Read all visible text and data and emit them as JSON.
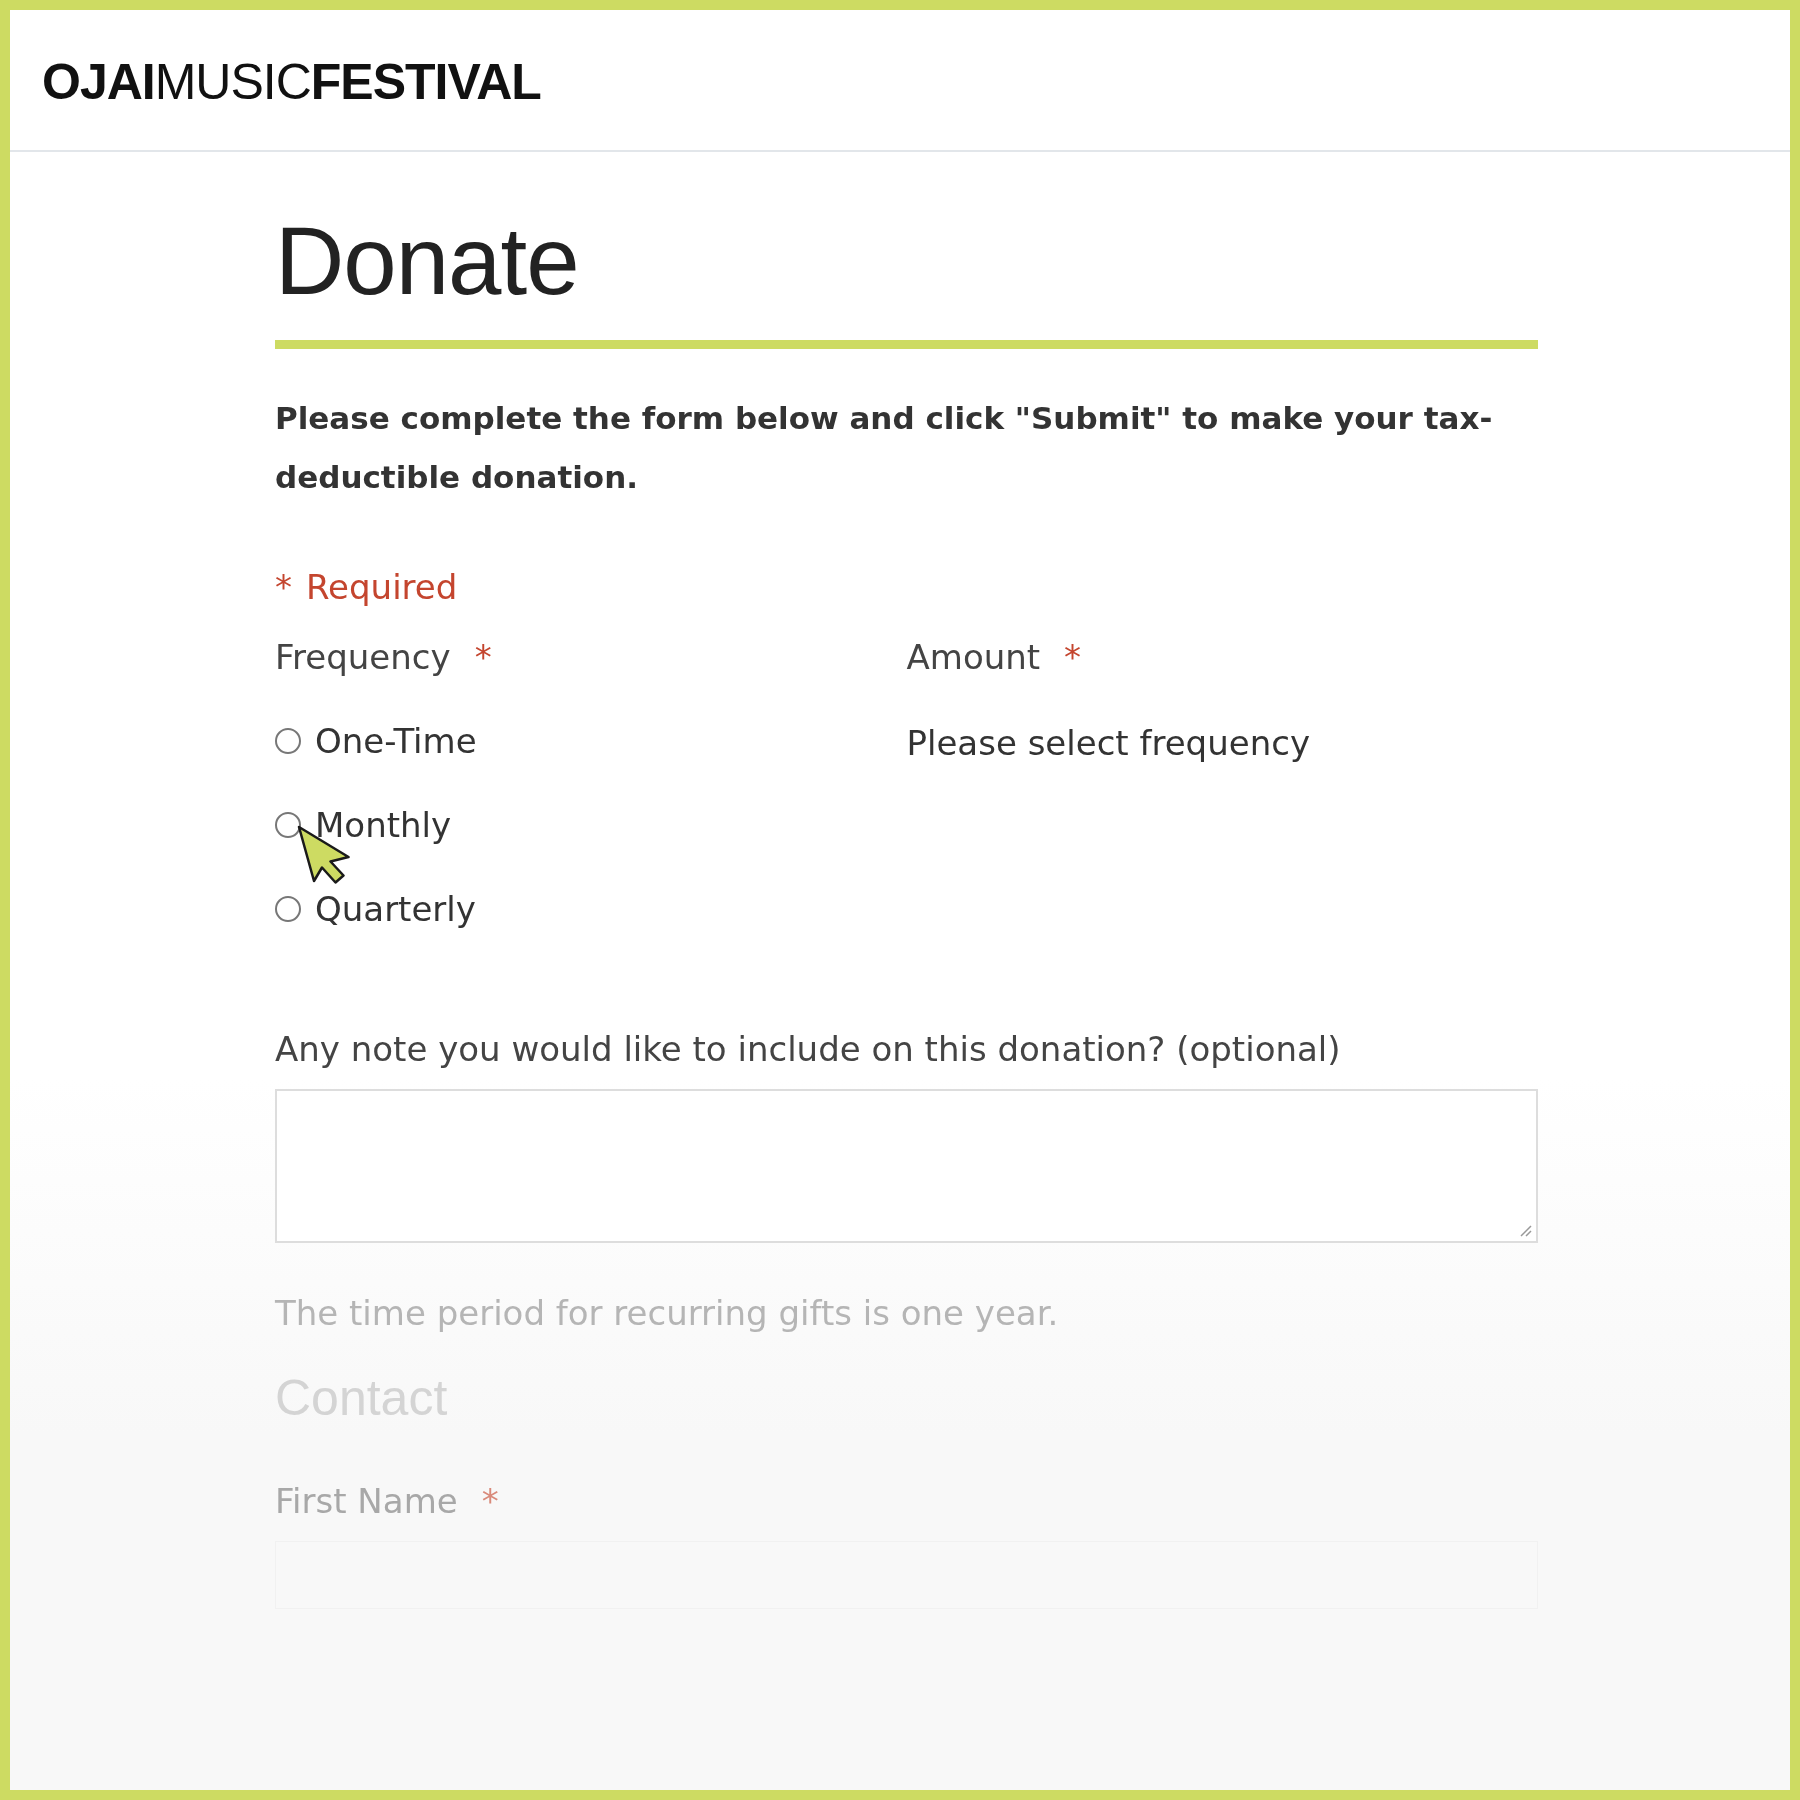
{
  "header": {
    "logo": "**OJAI**MUSIC**FESTIVAL**"
  },
  "title": "Donate",
  "intro": "Please complete the form below and click \"Submit\" to make your tax-deductible donation.",
  "required_note": {
    "mark": "*",
    "text": "Required"
  },
  "frequency": {
    "label": "Frequency",
    "mark": "*",
    "options": [
      {
        "label": "One-Time",
        "selected": false
      },
      {
        "label": "Monthly",
        "selected": false
      },
      {
        "label": "Quarterly",
        "selected": false
      }
    ]
  },
  "amount": {
    "label": "Amount",
    "mark": "*",
    "hint": "Please select frequency"
  },
  "note": {
    "label": "Any note you would like to include on this donation? (optional)"
  },
  "period_hint": "The time period for recurring gifts is one year.",
  "contact": {
    "title": "Contact",
    "first_name": {
      "label": "First Name",
      "mark": "*"
    }
  }
}
